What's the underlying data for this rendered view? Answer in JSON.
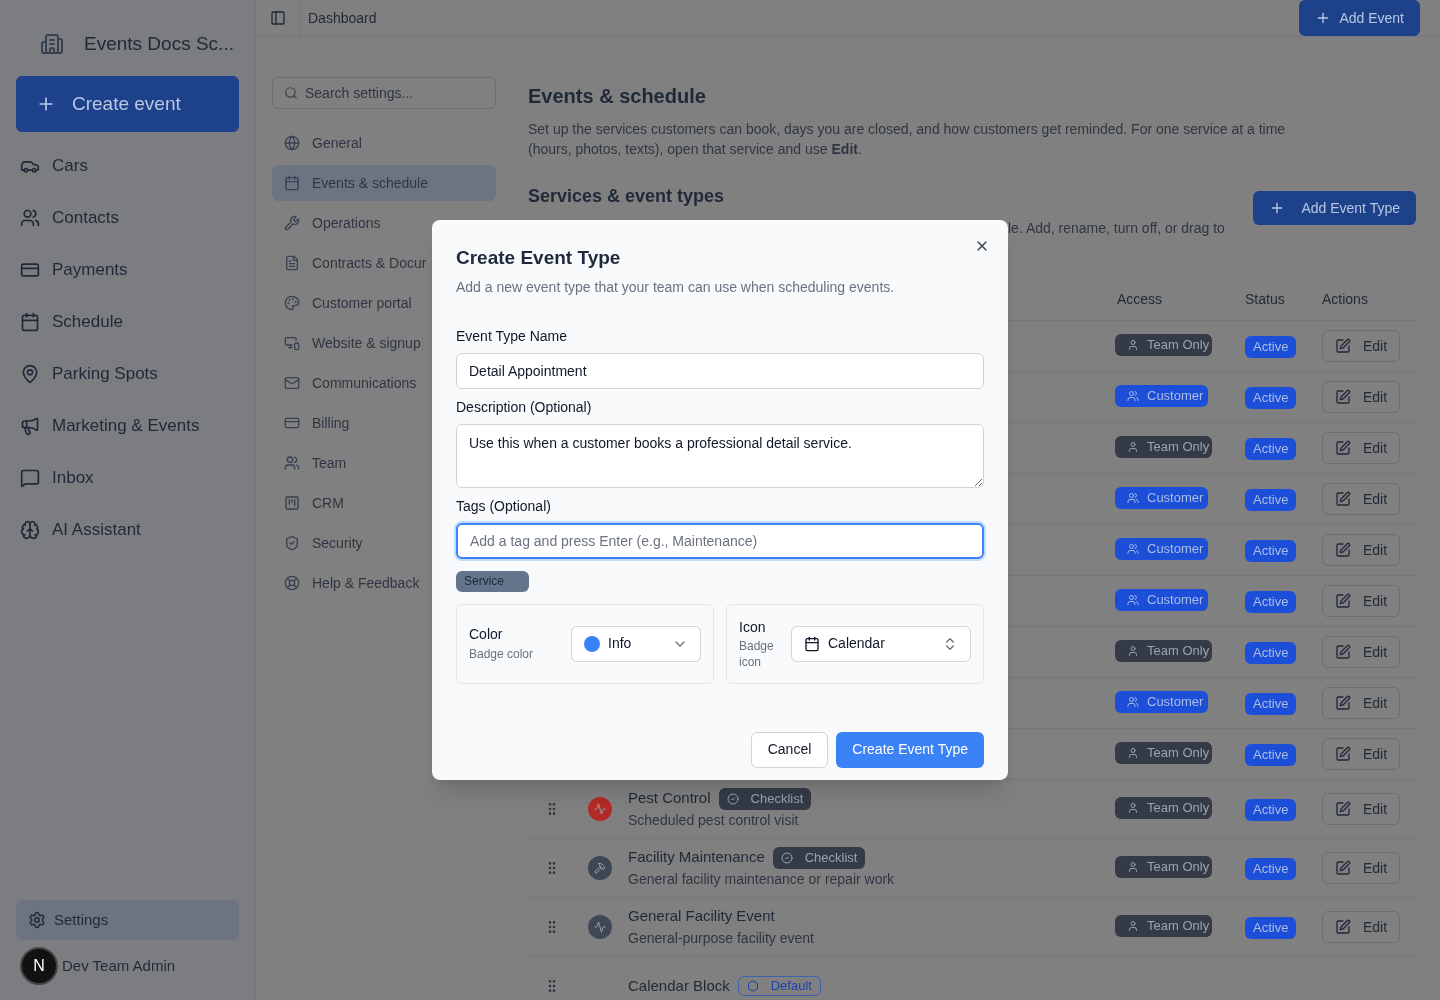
{
  "app": {
    "name": "Events Docs Sc...",
    "create_button": "Create event"
  },
  "sidebar": {
    "items": [
      {
        "label": "Cars",
        "selected": false
      },
      {
        "label": "Contacts",
        "selected": false
      },
      {
        "label": "Payments",
        "selected": false
      },
      {
        "label": "Schedule",
        "selected": false
      },
      {
        "label": "Parking Spots",
        "selected": false
      },
      {
        "label": "Marketing & Events",
        "selected": false
      },
      {
        "label": "Inbox",
        "selected": false
      },
      {
        "label": "AI Assistant",
        "selected": false
      }
    ],
    "settings": {
      "label": "Settings",
      "selected": true
    },
    "user": {
      "initial": "N",
      "name": "Dev Team Admin"
    }
  },
  "header": {
    "breadcrumb": "Dashboard",
    "add_button": "Add Event"
  },
  "settings_nav": {
    "search_placeholder": "Search settings...",
    "items": [
      {
        "label": "General",
        "selected": false
      },
      {
        "label": "Events & schedule",
        "selected": true
      },
      {
        "label": "Operations",
        "selected": false
      },
      {
        "label": "Contracts & Docur",
        "selected": false
      },
      {
        "label": "Customer portal",
        "selected": false
      },
      {
        "label": "Website & signup",
        "selected": false
      },
      {
        "label": "Communications",
        "selected": false
      },
      {
        "label": "Billing",
        "selected": false
      },
      {
        "label": "Team",
        "selected": false
      },
      {
        "label": "CRM",
        "selected": false
      },
      {
        "label": "Security",
        "selected": false
      },
      {
        "label": "Help & Feedback",
        "selected": false
      }
    ]
  },
  "page": {
    "title": "Events & schedule",
    "description": "Set up the services customers can book, days you are closed, and how customers get reminded. For one service at a time (hours, photos, texts), open that service and use **Edit**.",
    "section_title": "Services & event types",
    "section_description": "le. Add, rename, turn off, or drag to",
    "add_type_button": "Add Event Type"
  },
  "table": {
    "columns": [
      "Access",
      "Status",
      "Actions"
    ],
    "rows": [
      {
        "access": {
          "label": "Team Only",
          "kind": "team"
        },
        "status": "Active",
        "action": "Edit"
      },
      {
        "access": {
          "label": "Customer",
          "kind": "customer"
        },
        "status": "Active",
        "action": "Edit"
      },
      {
        "access": {
          "label": "Team Only",
          "kind": "team"
        },
        "status": "Active",
        "action": "Edit"
      },
      {
        "access": {
          "label": "Customer",
          "kind": "customer"
        },
        "status": "Active",
        "action": "Edit"
      },
      {
        "access": {
          "label": "Customer",
          "kind": "customer"
        },
        "status": "Active",
        "action": "Edit"
      },
      {
        "access": {
          "label": "Customer",
          "kind": "customer"
        },
        "status": "Active",
        "action": "Edit"
      },
      {
        "access": {
          "label": "Team Only",
          "kind": "team"
        },
        "status": "Active",
        "action": "Edit"
      },
      {
        "access": {
          "label": "Customer",
          "kind": "customer"
        },
        "status": "Active",
        "action": "Edit"
      },
      {
        "access": {
          "label": "Team Only",
          "kind": "team"
        },
        "status": "Active",
        "action": "Edit"
      },
      {
        "name": "Pest Control",
        "description": "Scheduled pest control visit",
        "color": "#b42b26",
        "badge": {
          "label": "Checklist",
          "kind": "checklist"
        },
        "access": {
          "label": "Team Only",
          "kind": "team"
        },
        "status": "Active",
        "action": "Edit"
      },
      {
        "name": "Facility Maintenance",
        "description": "General facility maintenance or repair work",
        "color": "#3f4654",
        "badge": {
          "label": "Checklist",
          "kind": "checklist"
        },
        "access": {
          "label": "Team Only",
          "kind": "team"
        },
        "status": "Active",
        "action": "Edit"
      },
      {
        "name": "General Facility Event",
        "description": "General-purpose facility event",
        "color": "#3f4654",
        "access": {
          "label": "Team Only",
          "kind": "team"
        },
        "status": "Active",
        "action": "Edit"
      },
      {
        "name": "Calendar Block",
        "badge": {
          "label": "Default",
          "kind": "default"
        }
      }
    ]
  },
  "dialog": {
    "title": "Create Event Type",
    "subtitle": "Add a new event type that your team can use when scheduling events.",
    "name_label": "Event Type Name",
    "name_value": "Detail Appointment",
    "description_label": "Description (Optional)",
    "description_value": "Use this when a customer books a professional detail service.",
    "tags_label": "Tags (Optional)",
    "tags_placeholder": "Add a tag and press Enter (e.g., Maintenance)",
    "tags": [
      "Service"
    ],
    "color_label": "Color",
    "color_hint": "Badge color",
    "color_value": "Info",
    "color": "#3b82f6",
    "icon_label": "Icon",
    "icon_hint": "Badge icon",
    "icon_value": "Calendar",
    "cancel": "Cancel",
    "submit": "Create Event Type"
  }
}
